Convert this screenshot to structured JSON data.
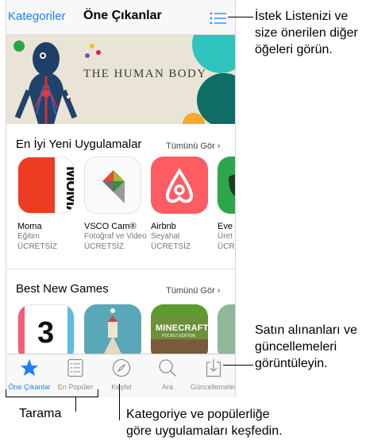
{
  "navbar": {
    "categories_label": "Kategoriler",
    "title": "Öne Çıkanlar",
    "list_icon": "list-icon"
  },
  "banner": {
    "title": "THE HUMAN BODY"
  },
  "sections": {
    "new_apps": {
      "title": "En İyi Yeni Uygulamalar",
      "see_all": "Tümünü Gör",
      "apps": [
        {
          "name": "Moma",
          "category": "Eğitim",
          "price": "ÜCRETSİZ",
          "icon_text": "MoMA"
        },
        {
          "name": "VSCO Cam®",
          "category": "Fotoğraf ve Video",
          "price": "ÜCRETSİZ"
        },
        {
          "name": "Airbnb",
          "category": "Seyahat",
          "price": "ÜCRETSİZ"
        },
        {
          "name": "Eve",
          "category": "Üret",
          "price": "ÜCR"
        }
      ]
    },
    "games": {
      "title": "Best New Games",
      "see_all": "Tümünü Gör",
      "icon_texts": [
        "3",
        "MINECRAFT",
        "POCKET EDITION"
      ]
    }
  },
  "tabbar": {
    "tabs": [
      {
        "label": "Öne Çıkanlar",
        "icon": "star-icon",
        "active": true
      },
      {
        "label": "En Popüler",
        "icon": "list-icon",
        "active": false
      },
      {
        "label": "Keşfet",
        "icon": "compass-icon",
        "active": false
      },
      {
        "label": "Ara",
        "icon": "search-icon",
        "active": false
      },
      {
        "label": "Güncellemeler",
        "icon": "update-icon",
        "active": false
      }
    ]
  },
  "callouts": {
    "wishlist": [
      "İstek Listenizi ve",
      "size önerilen diğer",
      "öğeleri görün."
    ],
    "updates": [
      "Satın alınanları ve",
      "güncellemeleri",
      "görüntüleyin."
    ],
    "browse": "Tarama",
    "discover": [
      "Kategoriye ve popülerliğe",
      "göre uygulamaları keşfedin."
    ]
  },
  "colors": {
    "accent": "#1a82fb",
    "airbnb": "#fd5c63",
    "moma": "#ee3b24"
  }
}
